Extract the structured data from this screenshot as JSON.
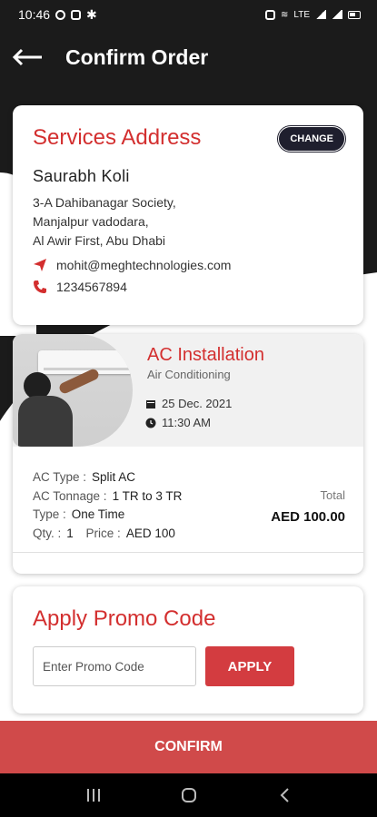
{
  "status_bar": {
    "time": "10:46",
    "network": "LTE"
  },
  "header": {
    "title": "Confirm Order"
  },
  "address_card": {
    "title": "Services Address",
    "change_label": "CHANGE",
    "name": "Saurabh Koli",
    "address_lines": [
      "3-A Dahibanagar Society,",
      "Manjalpur vadodara,",
      "Al Awir First, Abu Dhabi"
    ],
    "email": "mohit@meghtechnologies.com",
    "phone": "1234567894"
  },
  "service_card": {
    "title": "AC Installation",
    "category": "Air Conditioning",
    "date": "25 Dec. 2021",
    "time": "11:30 AM",
    "details": {
      "ac_type_label": "AC Type :",
      "ac_type": "Split AC",
      "tonnage_label": "AC Tonnage :",
      "tonnage": "1 TR to 3 TR",
      "type_label": "Type :",
      "type": "One Time",
      "qty_label": "Qty. :",
      "qty": "1",
      "price_label": "Price :",
      "price": "AED 100"
    },
    "total_label": "Total",
    "total_value": "AED 100.00"
  },
  "promo_card": {
    "title": "Apply Promo Code",
    "input_placeholder": "Enter Promo Code",
    "apply_label": "APPLY"
  },
  "confirm_label": "CONFIRM",
  "colors": {
    "accent": "#d32f2f",
    "button": "#d33c40",
    "dark": "#1b1b1b"
  }
}
